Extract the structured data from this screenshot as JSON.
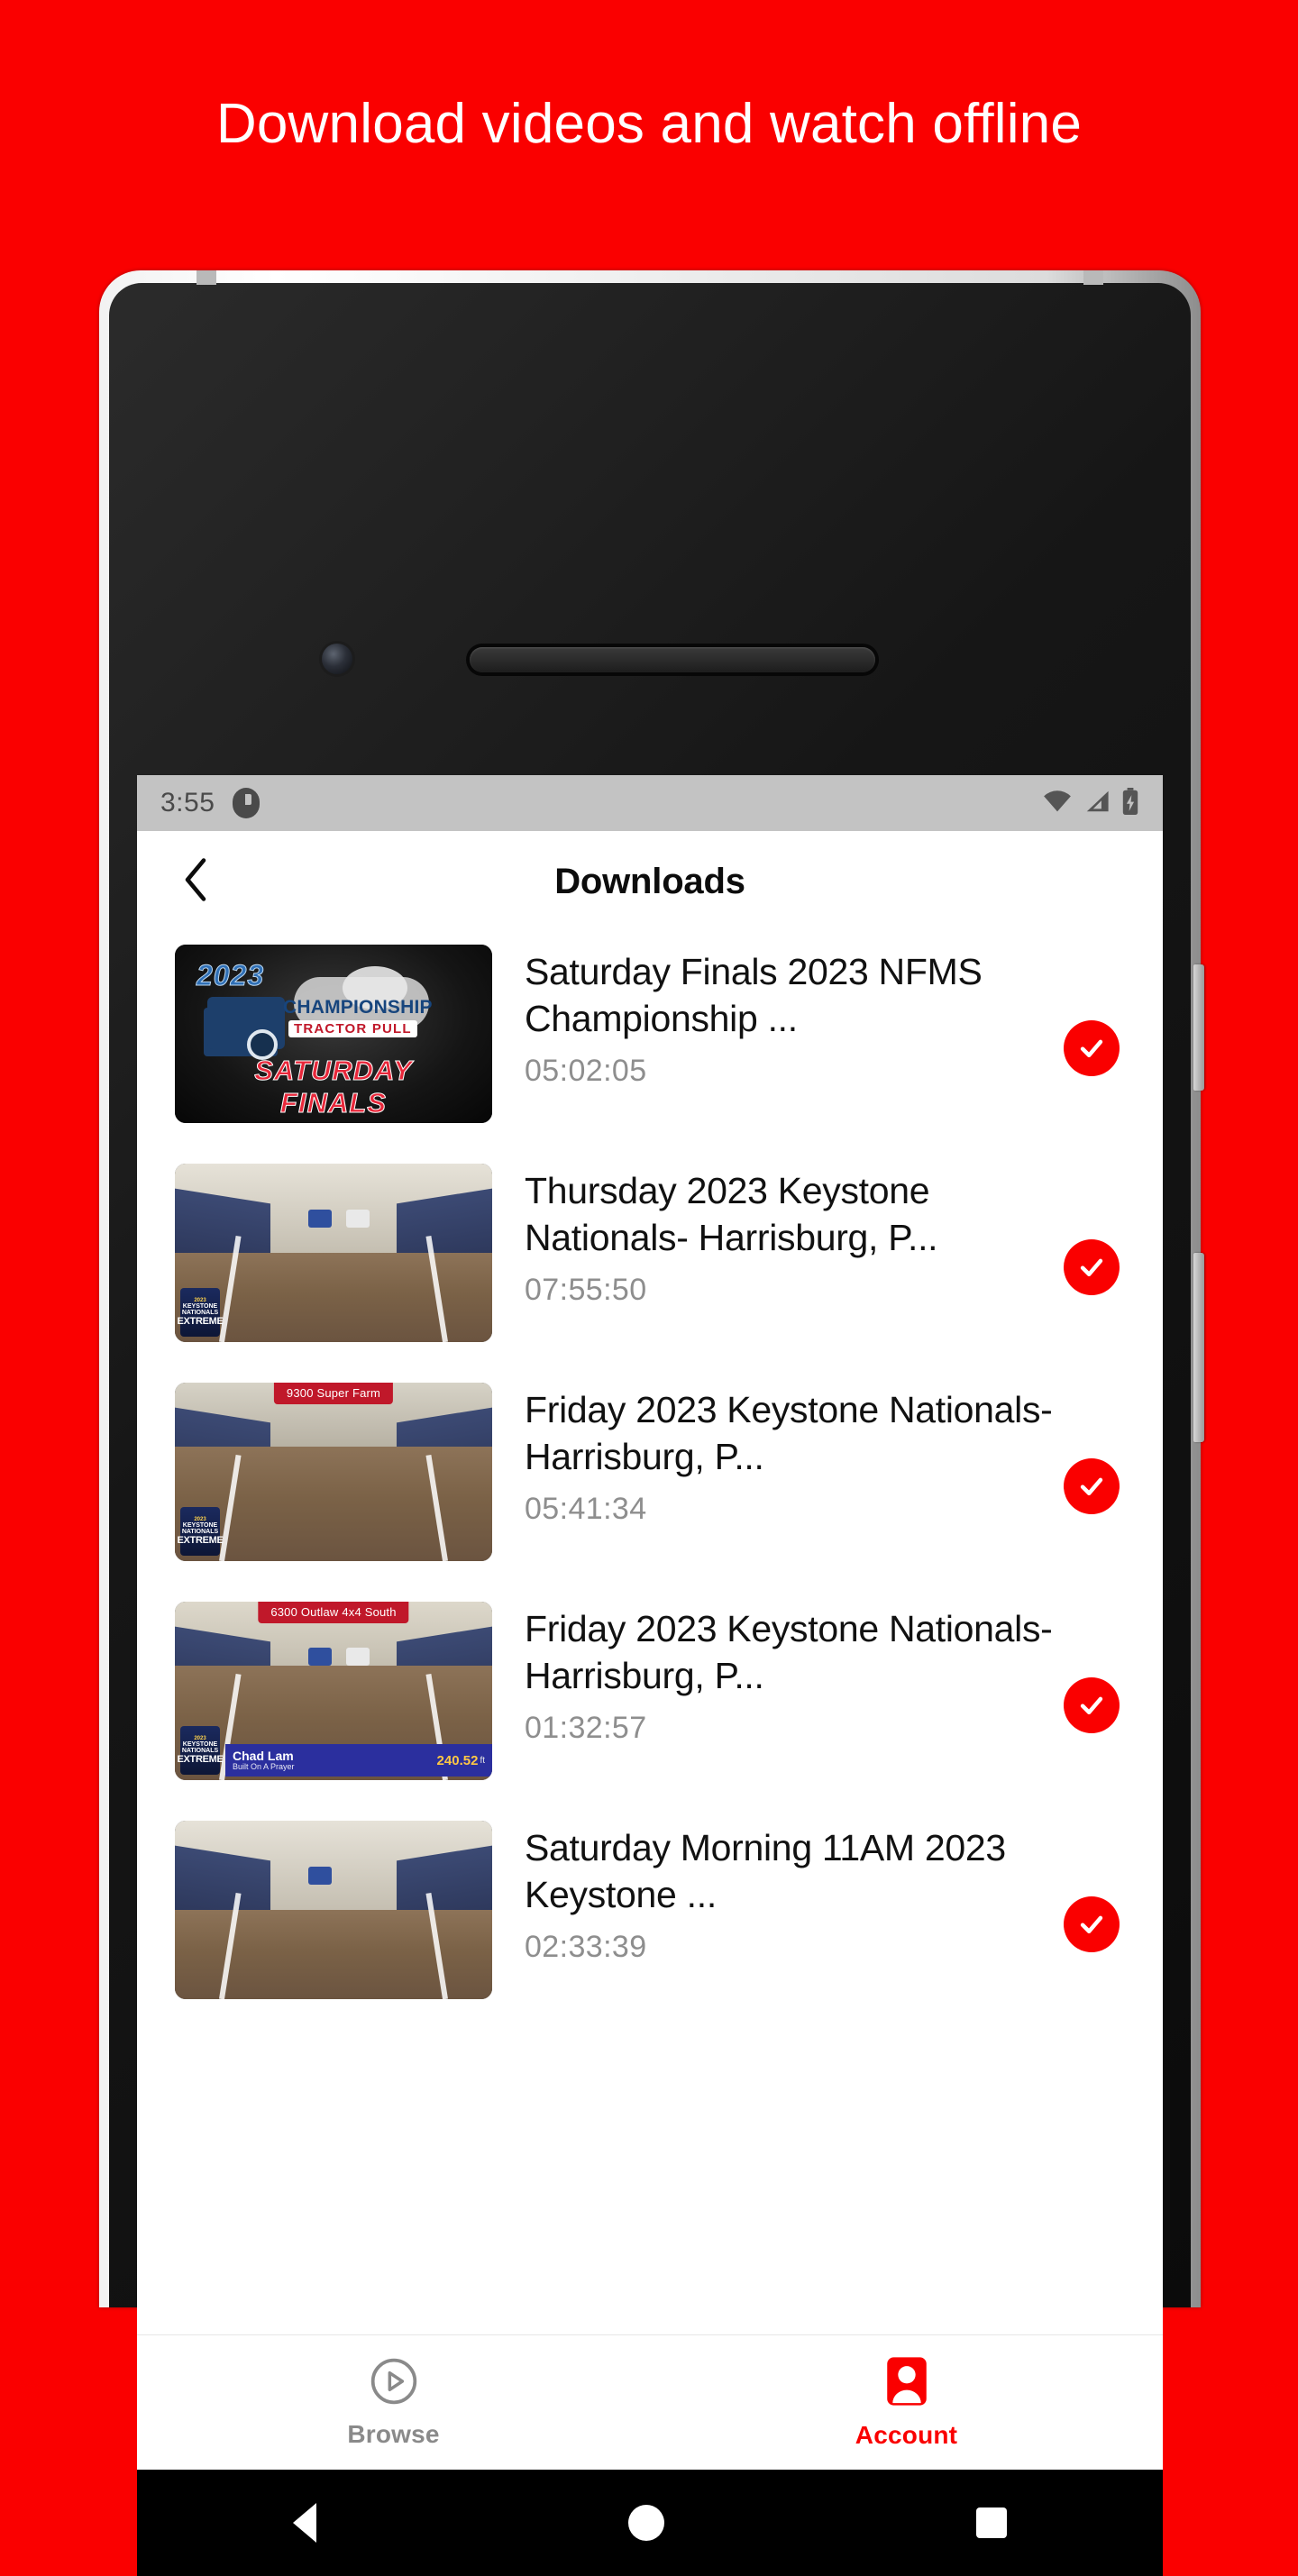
{
  "promo": {
    "headline": "Download videos and watch offline",
    "background_color": "#fa0000"
  },
  "phone": {
    "status_bar": {
      "time": "3:55",
      "app_icon": "notification-app-icon",
      "wifi_icon": "wifi-icon",
      "signal_icon": "cellular-signal-icon",
      "battery_icon": "battery-charging-icon"
    },
    "app_header": {
      "back_icon": "chevron-left-icon",
      "title": "Downloads"
    },
    "downloads": [
      {
        "title": "Saturday Finals 2023 NFMS Championship ...",
        "duration": "05:02:05",
        "status_icon": "check-circle-icon",
        "thumbnail": {
          "kind": "poster",
          "year": "2023",
          "line1": "CHAMPIONSHIP",
          "line2": "TRACTOR PULL",
          "line3": "SATURDAY",
          "line4": "FINALS"
        }
      },
      {
        "title": "Thursday 2023 Keystone Nationals- Harrisburg, P...",
        "duration": "07:55:50",
        "status_icon": "check-circle-icon",
        "thumbnail": {
          "kind": "arena",
          "banner": "",
          "logo_top": "2023",
          "logo_mid": "KEYSTONE NATIONALS",
          "logo_big": "EXTREME"
        }
      },
      {
        "title": "Friday 2023 Keystone Nationals- Harrisburg, P...",
        "duration": "05:41:34",
        "status_icon": "check-circle-icon",
        "thumbnail": {
          "kind": "arena",
          "banner": "9300 Super Farm",
          "logo_top": "2023",
          "logo_mid": "KEYSTONE NATIONALS",
          "logo_big": "EXTREME"
        }
      },
      {
        "title": "Friday 2023 Keystone Nationals- Harrisburg, P...",
        "duration": "01:32:57",
        "status_icon": "check-circle-icon",
        "thumbnail": {
          "kind": "arena",
          "banner": "6300 Outlaw 4x4 South",
          "logo_top": "2023",
          "logo_mid": "KEYSTONE NATIONALS",
          "logo_big": "EXTREME",
          "driver_name": "Chad Lam",
          "driver_vehicle": "Built On A Prayer",
          "distance": "240.52",
          "distance_unit": "ft"
        }
      },
      {
        "title": "Saturday Morning 11AM 2023 Keystone ...",
        "duration": "02:33:39",
        "status_icon": "check-circle-icon",
        "thumbnail": {
          "kind": "arena",
          "banner": "",
          "logo_top": "",
          "logo_mid": "",
          "logo_big": ""
        }
      }
    ],
    "tab_bar": {
      "active_color": "#fa0000",
      "inactive_color": "#8a8a8a",
      "tabs": [
        {
          "label": "Browse",
          "icon": "play-circle-icon",
          "active": false
        },
        {
          "label": "Account",
          "icon": "account-card-icon",
          "active": true
        }
      ]
    },
    "android_nav": {
      "back_icon": "triangle-back-icon",
      "home_icon": "circle-home-icon",
      "recents_icon": "square-recents-icon"
    }
  }
}
